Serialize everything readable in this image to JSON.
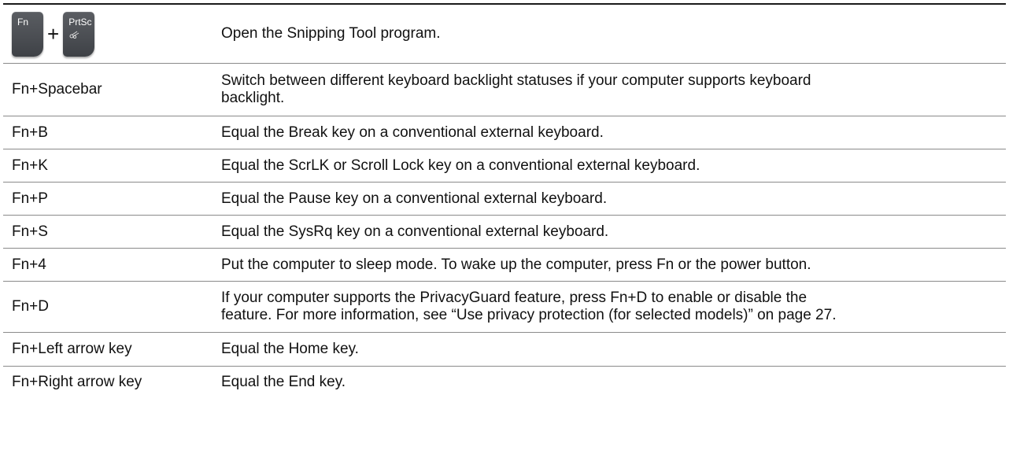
{
  "rows": [
    {
      "keys_image": {
        "key1_label": "Fn",
        "plus": "+",
        "key2_label": "PrtSc",
        "key2_icon": "snipping-tool-icon"
      },
      "description": "Open the Snipping Tool program."
    },
    {
      "keys": "Fn+Spacebar",
      "description_line1": "Switch between different keyboard backlight statuses if your computer supports keyboard",
      "description_line2": "backlight."
    },
    {
      "keys": "Fn+B",
      "description": "Equal the Break key on a conventional external keyboard."
    },
    {
      "keys": "Fn+K",
      "description": "Equal the ScrLK or Scroll Lock key on a conventional external keyboard."
    },
    {
      "keys": "Fn+P",
      "description": "Equal the Pause key on a conventional external keyboard."
    },
    {
      "keys": "Fn+S",
      "description": "Equal the SysRq key on a conventional external keyboard."
    },
    {
      "keys": "Fn+4",
      "description": "Put the computer to sleep mode. To wake up the computer, press Fn or the power button."
    },
    {
      "keys": "Fn+D",
      "description_line1": "If your computer supports the PrivacyGuard feature, press Fn+D to enable or disable the",
      "description_line2": "feature. For more information, see “Use privacy protection (for selected models)” on page 27."
    },
    {
      "keys": "Fn+Left arrow key",
      "description": "Equal the Home key."
    },
    {
      "keys": "Fn+Right arrow key",
      "description": "Equal the End key."
    }
  ],
  "colors": {
    "keycap": "#4a4d52",
    "rule": "#8a8a8a",
    "top_rule": "#1a1a1a"
  }
}
